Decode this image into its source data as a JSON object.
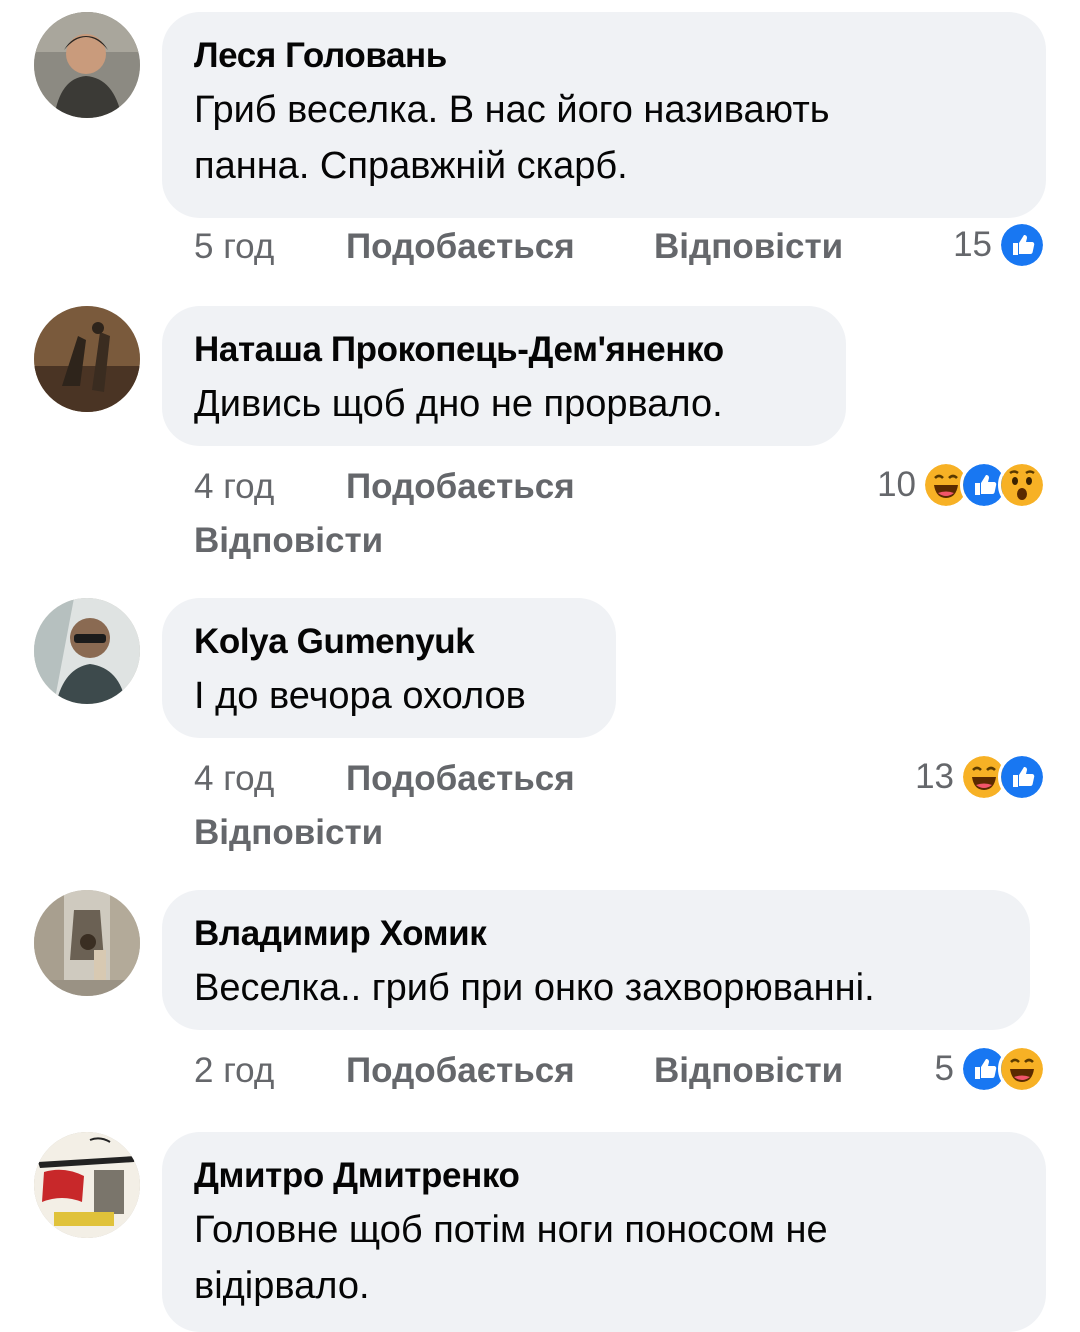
{
  "comments": [
    {
      "author": "Леся Головань",
      "text_lines": [
        "Гриб веселка. В нас його називають",
        "панна. Справжній скарб."
      ],
      "time": "5 год",
      "like_label": "Подобається",
      "reply_label": "Відповісти",
      "reaction_count": "15",
      "reactions": [
        "like-icon"
      ]
    },
    {
      "author": "Наташа Прокопець-Дем'яненко",
      "text_lines": [
        "Дивись щоб дно не прорвало."
      ],
      "time": "4 год",
      "like_label": "Подобається",
      "reply_label": "Відповісти",
      "reaction_count": "10",
      "reactions": [
        "haha-icon",
        "like-icon",
        "wow-icon"
      ]
    },
    {
      "author": "Kolya Gumenyuk",
      "text_lines": [
        "І до вечора охолов"
      ],
      "time": "4 год",
      "like_label": "Подобається",
      "reply_label": "Відповісти",
      "reaction_count": "13",
      "reactions": [
        "haha-icon",
        "like-icon"
      ]
    },
    {
      "author": "Владимир Хомик",
      "text_lines": [
        "Веселка.. гриб при онко захворюванні."
      ],
      "time": "2 год",
      "like_label": "Подобається",
      "reply_label": "Відповісти",
      "reaction_count": "5",
      "reactions": [
        "like-icon",
        "haha-icon"
      ]
    },
    {
      "author": "Дмитро Дмитренко",
      "text_lines": [
        "Головне щоб потім ноги поносом не",
        "відірвало."
      ]
    }
  ],
  "colors": {
    "like": "#1877f2",
    "haha": "#f7b125",
    "meta_text": "#65676b",
    "bubble": "#f0f2f5"
  }
}
